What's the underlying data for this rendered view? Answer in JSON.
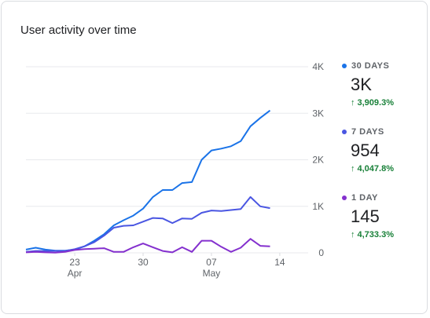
{
  "title": "User activity over time",
  "chart_data": {
    "type": "line",
    "title": "User activity over time",
    "x_ticks": [
      {
        "label": "23",
        "sublabel": "Apr",
        "x": 5
      },
      {
        "label": "30",
        "sublabel": "",
        "x": 12
      },
      {
        "label": "07",
        "sublabel": "May",
        "x": 19
      },
      {
        "label": "14",
        "sublabel": "",
        "x": 26
      }
    ],
    "y_ticks": [
      {
        "label": "4K",
        "value": 4000
      },
      {
        "label": "3K",
        "value": 3000
      },
      {
        "label": "2K",
        "value": 2000
      },
      {
        "label": "1K",
        "value": 1000
      },
      {
        "label": "0",
        "value": 0
      }
    ],
    "ylim": [
      0,
      4000
    ],
    "xlim": [
      0,
      31
    ],
    "grid": true,
    "legend_position": "right",
    "series": [
      {
        "name": "30 DAYS",
        "color": "#1a73e8",
        "values": [
          70,
          110,
          70,
          45,
          45,
          70,
          140,
          260,
          400,
          590,
          700,
          800,
          950,
          1200,
          1350,
          1350,
          1500,
          1520,
          2000,
          2200,
          2240,
          2290,
          2400,
          2720,
          2900,
          3060
        ]
      },
      {
        "name": "7 DAYS",
        "color": "#4a56e2",
        "values": [
          20,
          40,
          40,
          40,
          40,
          80,
          140,
          230,
          370,
          540,
          580,
          590,
          670,
          750,
          740,
          640,
          740,
          730,
          860,
          910,
          900,
          920,
          940,
          1200,
          1000,
          960
        ]
      },
      {
        "name": "1 DAY",
        "color": "#8430ce",
        "values": [
          10,
          20,
          10,
          5,
          20,
          60,
          80,
          90,
          100,
          20,
          20,
          120,
          200,
          120,
          40,
          10,
          120,
          20,
          260,
          260,
          130,
          20,
          110,
          300,
          150,
          140
        ]
      }
    ],
    "x_start": 0,
    "x_step": 1
  },
  "legend": [
    {
      "label": "30 DAYS",
      "value": "3K",
      "change": "3,909.3%",
      "color": "#1a73e8"
    },
    {
      "label": "7 DAYS",
      "value": "954",
      "change": "4,047.8%",
      "color": "#4a56e2"
    },
    {
      "label": "1 DAY",
      "value": "145",
      "change": "4,733.3%",
      "color": "#8430ce"
    }
  ],
  "colors": {
    "positive": "#188038",
    "grid": "#e8eaed",
    "axis_text": "#5f6368"
  }
}
